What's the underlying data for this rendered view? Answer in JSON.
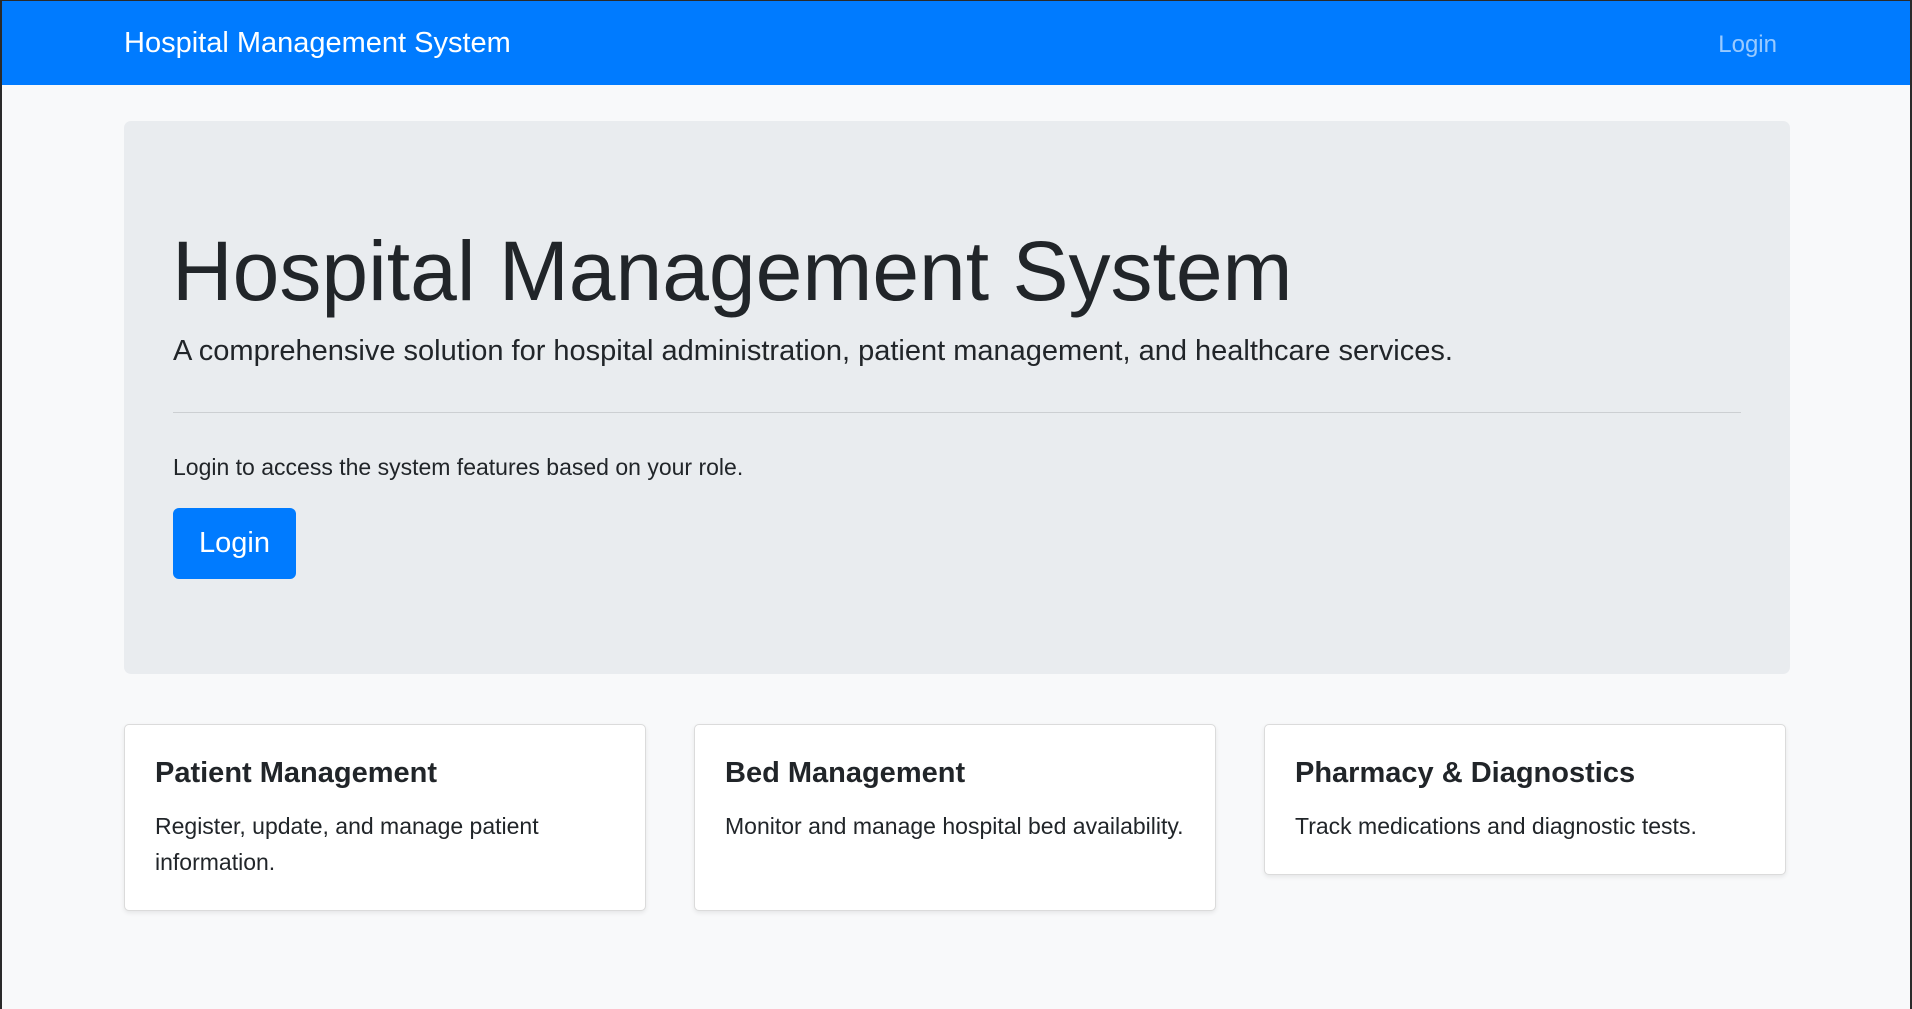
{
  "navbar": {
    "brand": "Hospital Management System",
    "login_link": "Login",
    "background_color": "#007bff"
  },
  "hero": {
    "title": "Hospital Management System",
    "lead": "A comprehensive solution for hospital administration, patient management, and healthcare services.",
    "text": "Login to access the system features based on your role.",
    "button_label": "Login"
  },
  "cards": [
    {
      "title": "Patient Management",
      "text": "Register, update, and manage patient information."
    },
    {
      "title": "Bed Management",
      "text": "Monitor and manage hospital bed availability."
    },
    {
      "title": "Pharmacy & Diagnostics",
      "text": "Track medications and diagnostic tests."
    }
  ],
  "colors": {
    "primary": "#007bff",
    "page_background": "#f8f9fa",
    "jumbotron_background": "#e9ecef"
  }
}
